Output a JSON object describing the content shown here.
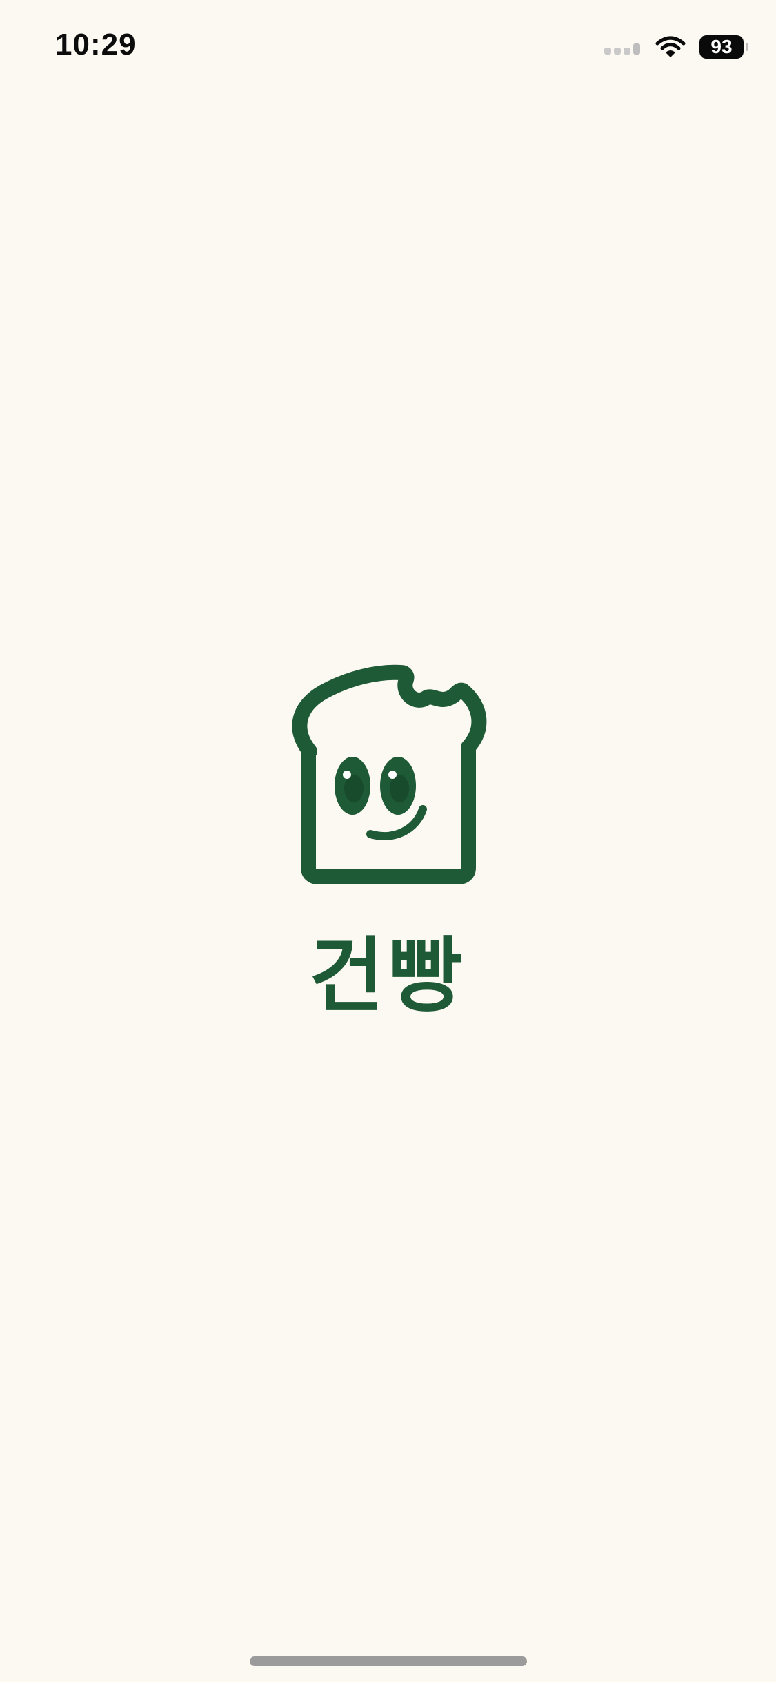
{
  "status_bar": {
    "time": "10:29",
    "battery_level": "93",
    "icons": [
      "cellular-signal-icon",
      "wifi-icon",
      "battery-icon"
    ]
  },
  "splash": {
    "logo_icon": "bread-mascot-icon",
    "app_name": "건빵"
  },
  "colors": {
    "background": "#FBF9F2",
    "brand_green": "#1F5A36",
    "status_text": "#0C0C0C"
  }
}
